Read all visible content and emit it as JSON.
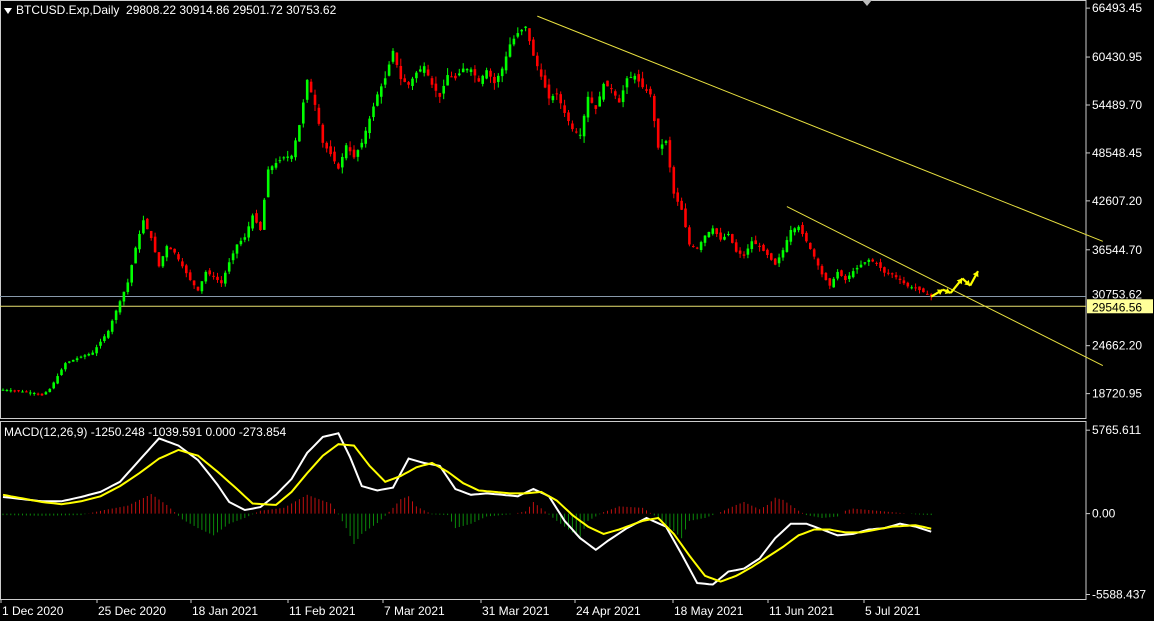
{
  "header": {
    "symbol": "BTCUSD.Exp,Daily",
    "ohlc": "29808.22 30914.86 29501.72 30753.62",
    "macd": "MACD(12,26,9) -1250.248 -1039.591 0.000 -273.854"
  },
  "chart_data": [
    {
      "type": "candlestick",
      "ylim": [
        15700,
        67500
      ],
      "price_ticks": [
        {
          "label": "66493.45",
          "value": 66493.45
        },
        {
          "label": "60430.95",
          "value": 60430.95
        },
        {
          "label": "54489.70",
          "value": 54489.7
        },
        {
          "label": "48548.45",
          "value": 48548.45
        },
        {
          "label": "42607.20",
          "value": 42607.2
        },
        {
          "label": "36544.70",
          "value": 36544.7
        },
        {
          "label": "24662.20",
          "value": 24662.2
        },
        {
          "label": "18720.95",
          "value": 18720.95
        }
      ],
      "current_price": {
        "label": "30753.62",
        "value": 30753.62
      },
      "level": {
        "label": "29546.56",
        "value": 29546.56
      },
      "x_labels": [
        "1 Dec 2020",
        "25 Dec 2020",
        "18 Jan 2021",
        "11 Feb 2021",
        "7 Mar 2021",
        "31 Mar 2021",
        "24 Apr 2021",
        "18 May 2021",
        "11 Jun 2021",
        "5 Jul 2021"
      ],
      "close_path": [
        [
          0,
          19200
        ],
        [
          3,
          19100
        ],
        [
          8,
          18800
        ],
        [
          10,
          18500
        ],
        [
          12,
          19300
        ],
        [
          16,
          22500
        ],
        [
          20,
          23300
        ],
        [
          23,
          23800
        ],
        [
          27,
          26500
        ],
        [
          29,
          29000
        ],
        [
          32,
          32500
        ],
        [
          34,
          36800
        ],
        [
          36,
          40200
        ],
        [
          38,
          38000
        ],
        [
          40,
          34500
        ],
        [
          42,
          37000
        ],
        [
          44,
          36200
        ],
        [
          46,
          34500
        ],
        [
          48,
          32800
        ],
        [
          50,
          31500
        ],
        [
          52,
          33800
        ],
        [
          54,
          33200
        ],
        [
          56,
          32400
        ],
        [
          58,
          35000
        ],
        [
          60,
          37200
        ],
        [
          62,
          38100
        ],
        [
          64,
          40800
        ],
        [
          66,
          39000
        ],
        [
          68,
          46500
        ],
        [
          70,
          47300
        ],
        [
          72,
          48000
        ],
        [
          74,
          48200
        ],
        [
          76,
          52000
        ],
        [
          78,
          57600
        ],
        [
          80,
          54500
        ],
        [
          82,
          49800
        ],
        [
          84,
          48400
        ],
        [
          86,
          46600
        ],
        [
          88,
          49500
        ],
        [
          90,
          48000
        ],
        [
          92,
          49800
        ],
        [
          94,
          52800
        ],
        [
          96,
          55800
        ],
        [
          98,
          57800
        ],
        [
          100,
          61200
        ],
        [
          102,
          57700
        ],
        [
          104,
          57000
        ],
        [
          106,
          58500
        ],
        [
          108,
          59300
        ],
        [
          110,
          57000
        ],
        [
          112,
          55500
        ],
        [
          114,
          58200
        ],
        [
          116,
          57800
        ],
        [
          118,
          59000
        ],
        [
          120,
          58900
        ],
        [
          122,
          57400
        ],
        [
          124,
          58800
        ],
        [
          126,
          57200
        ],
        [
          128,
          59000
        ],
        [
          130,
          62000
        ],
        [
          132,
          63400
        ],
        [
          134,
          64200
        ],
        [
          136,
          60600
        ],
        [
          138,
          58000
        ],
        [
          140,
          55300
        ],
        [
          142,
          55900
        ],
        [
          144,
          53500
        ],
        [
          146,
          51500
        ],
        [
          148,
          50800
        ],
        [
          150,
          55500
        ],
        [
          152,
          54000
        ],
        [
          154,
          57100
        ],
        [
          156,
          56500
        ],
        [
          158,
          54800
        ],
        [
          160,
          57800
        ],
        [
          162,
          58100
        ],
        [
          164,
          56700
        ],
        [
          166,
          55800
        ],
        [
          168,
          49200
        ],
        [
          170,
          50000
        ],
        [
          172,
          43500
        ],
        [
          174,
          41500
        ],
        [
          176,
          37200
        ],
        [
          178,
          36700
        ],
        [
          180,
          38300
        ],
        [
          182,
          39200
        ],
        [
          184,
          37800
        ],
        [
          186,
          38500
        ],
        [
          188,
          36300
        ],
        [
          190,
          35800
        ],
        [
          192,
          37600
        ],
        [
          194,
          36900
        ],
        [
          196,
          35900
        ],
        [
          198,
          34700
        ],
        [
          200,
          36500
        ],
        [
          202,
          39000
        ],
        [
          204,
          39400
        ],
        [
          206,
          37600
        ],
        [
          208,
          35700
        ],
        [
          210,
          33500
        ],
        [
          212,
          32100
        ],
        [
          214,
          33800
        ],
        [
          216,
          32800
        ],
        [
          218,
          33900
        ],
        [
          220,
          34700
        ],
        [
          222,
          35300
        ],
        [
          224,
          34900
        ],
        [
          226,
          33700
        ],
        [
          228,
          33500
        ],
        [
          230,
          32800
        ],
        [
          232,
          32000
        ],
        [
          234,
          31800
        ],
        [
          236,
          31300
        ],
        [
          238,
          30753.62
        ]
      ],
      "forecast_path": [
        [
          238,
          30753.62
        ],
        [
          241,
          31600
        ],
        [
          243,
          31200
        ],
        [
          246,
          33000
        ],
        [
          248,
          32100
        ],
        [
          250,
          33900
        ]
      ],
      "trendlines": [
        {
          "from": [
            137,
            65500
          ],
          "to": [
            282,
            37600
          ]
        },
        {
          "from": [
            201,
            41900
          ],
          "to": [
            282,
            22200
          ]
        }
      ]
    },
    {
      "type": "line",
      "name": "MACD(12,26,9)",
      "ylim": [
        -5900,
        6400
      ],
      "ticks": [
        {
          "label": "5765.611",
          "value": 5765.611
        },
        {
          "label": "0.00",
          "value": 0
        },
        {
          "label": "-5588.437",
          "value": -5588.437
        }
      ],
      "series": [
        {
          "values_path": [
            [
              0,
              1150
            ],
            [
              10,
              850
            ],
            [
              15,
              850
            ],
            [
              20,
              1150
            ],
            [
              25,
              1500
            ],
            [
              30,
              2200
            ],
            [
              35,
              3700
            ],
            [
              40,
              5200
            ],
            [
              45,
              4700
            ],
            [
              50,
              3700
            ],
            [
              55,
              2000
            ],
            [
              58,
              800
            ],
            [
              62,
              250
            ],
            [
              66,
              450
            ],
            [
              70,
              1300
            ],
            [
              74,
              2400
            ],
            [
              78,
              4200
            ],
            [
              82,
              5300
            ],
            [
              86,
              5550
            ],
            [
              89,
              3900
            ],
            [
              92,
              1900
            ],
            [
              96,
              1600
            ],
            [
              100,
              1800
            ],
            [
              104,
              3800
            ],
            [
              108,
              3500
            ],
            [
              112,
              3300
            ],
            [
              116,
              1700
            ],
            [
              120,
              1300
            ],
            [
              124,
              1400
            ],
            [
              128,
              1300
            ],
            [
              132,
              1200
            ],
            [
              136,
              1700
            ],
            [
              140,
              1200
            ],
            [
              144,
              -500
            ],
            [
              148,
              -1700
            ],
            [
              152,
              -2500
            ],
            [
              155,
              -1900
            ],
            [
              160,
              -1000
            ],
            [
              165,
              -300
            ],
            [
              170,
              -900
            ],
            [
              174,
              -2800
            ],
            [
              178,
              -4800
            ],
            [
              182,
              -4900
            ],
            [
              186,
              -4000
            ],
            [
              190,
              -3800
            ],
            [
              194,
              -3100
            ],
            [
              198,
              -1700
            ],
            [
              202,
              -700
            ],
            [
              206,
              -700
            ],
            [
              210,
              -1100
            ],
            [
              214,
              -1500
            ],
            [
              218,
              -1400
            ],
            [
              222,
              -1100
            ],
            [
              226,
              -1000
            ],
            [
              230,
              -700
            ],
            [
              234,
              -900
            ],
            [
              238,
              -1250.248
            ]
          ]
        },
        {
          "values_path": [
            [
              0,
              1300
            ],
            [
              10,
              800
            ],
            [
              15,
              650
            ],
            [
              20,
              850
            ],
            [
              25,
              1200
            ],
            [
              30,
              1900
            ],
            [
              35,
              2800
            ],
            [
              40,
              3800
            ],
            [
              45,
              4400
            ],
            [
              50,
              4000
            ],
            [
              55,
              2900
            ],
            [
              60,
              1700
            ],
            [
              64,
              700
            ],
            [
              70,
              600
            ],
            [
              74,
              1500
            ],
            [
              78,
              2800
            ],
            [
              82,
              4000
            ],
            [
              86,
              4800
            ],
            [
              90,
              4700
            ],
            [
              94,
              3300
            ],
            [
              98,
              2200
            ],
            [
              102,
              2600
            ],
            [
              106,
              3200
            ],
            [
              110,
              3500
            ],
            [
              114,
              2900
            ],
            [
              118,
              2100
            ],
            [
              122,
              1600
            ],
            [
              126,
              1500
            ],
            [
              130,
              1400
            ],
            [
              134,
              1400
            ],
            [
              138,
              1500
            ],
            [
              142,
              900
            ],
            [
              146,
              -100
            ],
            [
              150,
              -900
            ],
            [
              154,
              -1400
            ],
            [
              158,
              -1100
            ],
            [
              164,
              -500
            ],
            [
              168,
              -300
            ],
            [
              172,
              -1400
            ],
            [
              176,
              -2900
            ],
            [
              180,
              -4300
            ],
            [
              184,
              -4700
            ],
            [
              188,
              -4300
            ],
            [
              192,
              -3700
            ],
            [
              196,
              -3000
            ],
            [
              200,
              -2300
            ],
            [
              204,
              -1500
            ],
            [
              208,
              -1100
            ],
            [
              212,
              -1100
            ],
            [
              216,
              -1300
            ],
            [
              220,
              -1300
            ],
            [
              224,
              -1100
            ],
            [
              228,
              -900
            ],
            [
              234,
              -800
            ],
            [
              238,
              -1039.591
            ]
          ]
        }
      ],
      "histogram_path": [
        [
          0,
          -100
        ],
        [
          10,
          -150
        ],
        [
          20,
          -100
        ],
        [
          26,
          250
        ],
        [
          32,
          550
        ],
        [
          38,
          1350
        ],
        [
          42,
          600
        ],
        [
          46,
          -400
        ],
        [
          50,
          -1000
        ],
        [
          54,
          -1500
        ],
        [
          58,
          -700
        ],
        [
          62,
          -300
        ],
        [
          66,
          200
        ],
        [
          72,
          400
        ],
        [
          78,
          1300
        ],
        [
          84,
          700
        ],
        [
          86,
          -50
        ],
        [
          88,
          -1000
        ],
        [
          90,
          -2100
        ],
        [
          92,
          -1400
        ],
        [
          96,
          -650
        ],
        [
          98,
          -150
        ],
        [
          100,
          400
        ],
        [
          102,
          1000
        ],
        [
          104,
          1200
        ],
        [
          106,
          500
        ],
        [
          110,
          -50
        ],
        [
          114,
          -100
        ],
        [
          116,
          -1000
        ],
        [
          120,
          -700
        ],
        [
          124,
          -200
        ],
        [
          130,
          -50
        ],
        [
          134,
          150
        ],
        [
          136,
          800
        ],
        [
          139,
          150
        ],
        [
          142,
          -500
        ],
        [
          146,
          -1300
        ],
        [
          148,
          -1600
        ],
        [
          150,
          -500
        ],
        [
          154,
          100
        ],
        [
          158,
          500
        ],
        [
          164,
          400
        ],
        [
          168,
          -300
        ],
        [
          172,
          -1200
        ],
        [
          174,
          -1700
        ],
        [
          176,
          -500
        ],
        [
          180,
          -300
        ],
        [
          184,
          100
        ],
        [
          188,
          600
        ],
        [
          190,
          800
        ],
        [
          194,
          300
        ],
        [
          196,
          600
        ],
        [
          198,
          1100
        ],
        [
          200,
          950
        ],
        [
          204,
          200
        ],
        [
          206,
          -100
        ],
        [
          210,
          -300
        ],
        [
          214,
          -200
        ],
        [
          216,
          200
        ],
        [
          218,
          350
        ],
        [
          222,
          250
        ],
        [
          226,
          150
        ],
        [
          230,
          50
        ],
        [
          234,
          -50
        ],
        [
          238,
          -100
        ]
      ]
    }
  ]
}
